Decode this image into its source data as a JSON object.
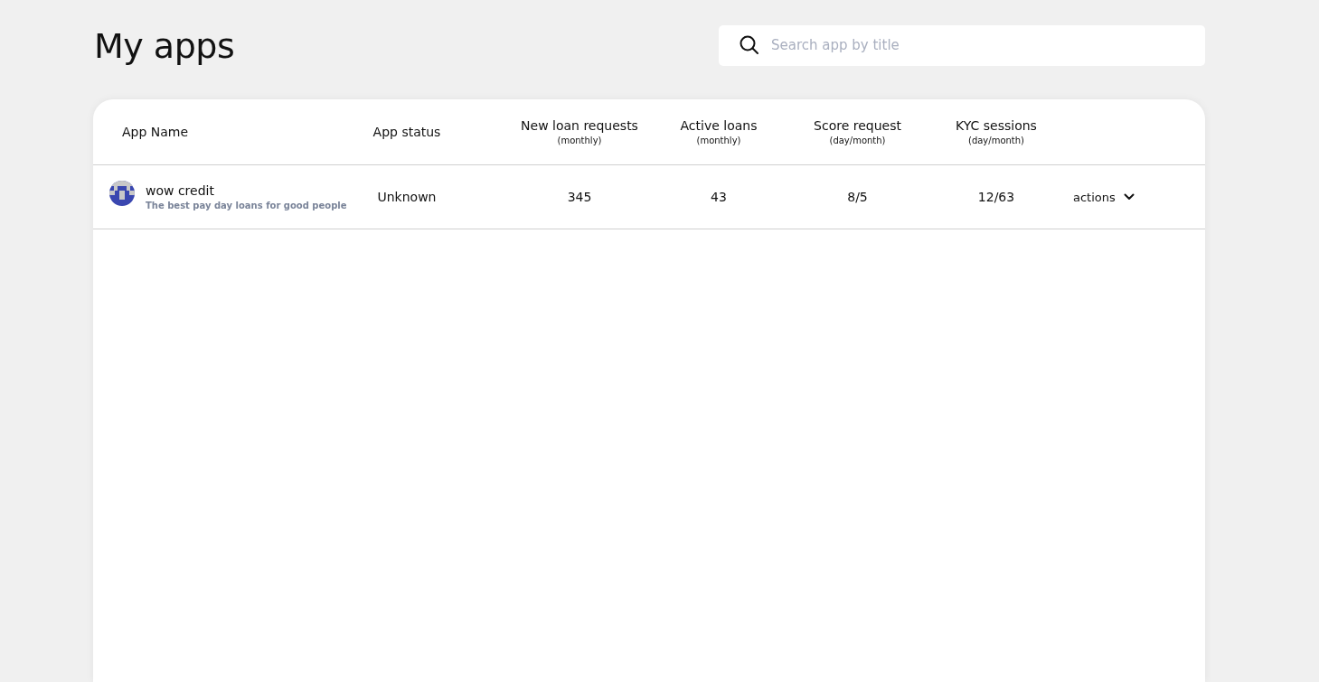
{
  "page": {
    "title": "My apps"
  },
  "search": {
    "placeholder": "Search app by title"
  },
  "table": {
    "columns": [
      {
        "label": "App Name"
      },
      {
        "label": "App status"
      },
      {
        "label": "New loan requests",
        "sublabel": "(monthly)"
      },
      {
        "label": "Active loans",
        "sublabel": "(monthly)"
      },
      {
        "label": "Score request",
        "sublabel": "(day/month)"
      },
      {
        "label": "KYC sessions",
        "sublabel": "(day/month)"
      }
    ],
    "rows": [
      {
        "name": "wow credit",
        "description": "The best pay day loans for good people",
        "status": "Unknown",
        "new_loan_requests": "345",
        "active_loans": "43",
        "score_request": "8/5",
        "kyc_sessions": "12/63",
        "action": "actions"
      }
    ]
  }
}
